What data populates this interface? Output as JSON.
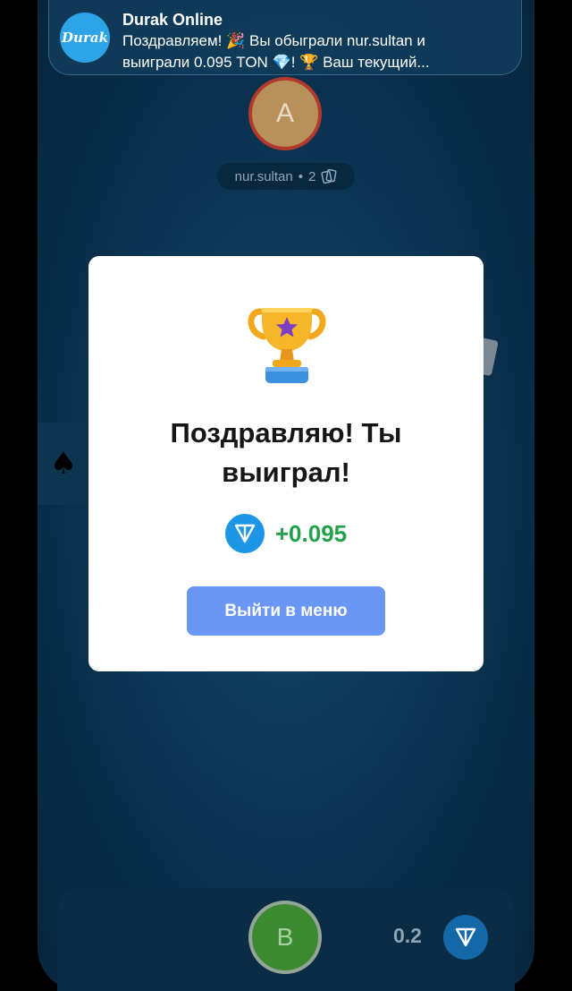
{
  "notification": {
    "app_name": "Durak Online",
    "logo_text": "Durak",
    "message": "Поздравляем! 🎉 Вы обыграли nur.sultan и\nвыиграли 0.095 TON 💎! 🏆 Ваш текущий..."
  },
  "opponent": {
    "avatar_letter": "A",
    "name": "nur.sultan",
    "separator": "•",
    "card_count": "2"
  },
  "trump": {
    "suit_symbol": "♠"
  },
  "modal": {
    "title": "Поздравляю! Ты\nвыиграл!",
    "reward_amount": "+0.095",
    "exit_button_label": "Выйти в меню"
  },
  "player": {
    "avatar_letter": "B",
    "bet": "0.2"
  },
  "colors": {
    "accent_button": "#6a97f4",
    "reward_green": "#23a04a",
    "ton_blue": "#1e96e6",
    "table_bg": "#0b3453"
  }
}
